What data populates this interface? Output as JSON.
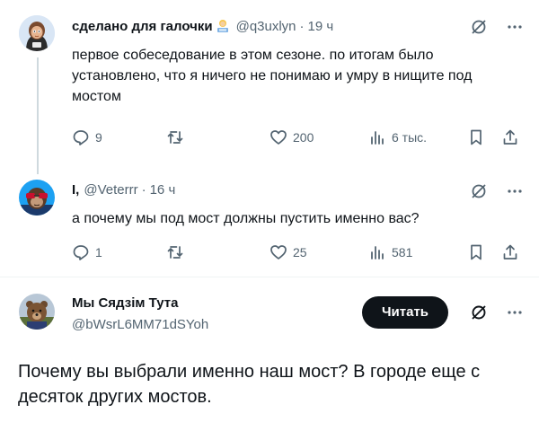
{
  "tweet1": {
    "display_name": "сделано для галочки",
    "handle": "@q3uxlyn",
    "separator": "·",
    "time": "19 ч",
    "text": "первое собеседование в этом сезоне. по итогам было установлено, что я ничего не понимаю и умру в нищите под мостом",
    "replies": "9",
    "likes": "200",
    "views": "6 тыс."
  },
  "tweet2": {
    "display_name": "I,",
    "handle": "@Veterrr",
    "separator": "·",
    "time": "16 ч",
    "text": "а почему мы под мост должны пустить именно вас?",
    "replies": "1",
    "likes": "25",
    "views": "581"
  },
  "main_tweet": {
    "display_name": "Мы Сядзім Тута",
    "handle": "@bWsrL6MM71dSYoh",
    "follow_label": "Читать",
    "text": "Почему вы выбрали именно наш мост? В городе еще с десяток других мостов."
  },
  "icons": {
    "reply": "reply-icon",
    "retweet": "retweet-icon",
    "like": "heart-icon",
    "views": "views-icon",
    "bookmark": "bookmark-icon",
    "share": "share-icon",
    "grok": "grok-icon",
    "more": "more-icon"
  },
  "colors": {
    "text": "#0f1419",
    "secondary": "#536471",
    "thread_line": "#cfd9de",
    "follow_button": "#0f1419"
  }
}
